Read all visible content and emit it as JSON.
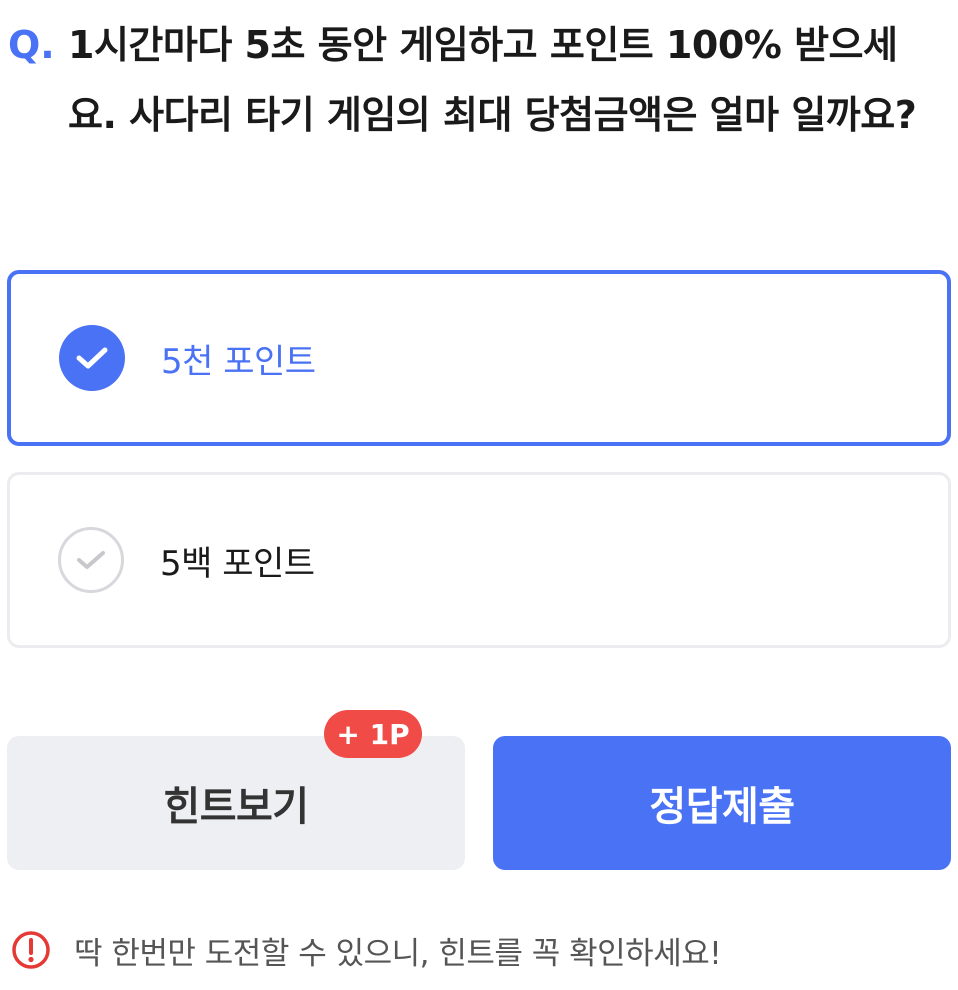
{
  "question": {
    "prefix": "Q.",
    "text": "1시간마다 5초 동안 게임하고 포인트 100% 받으세요. 사다리 타기 게임의 최대 당첨금액은 얼마 일까요?"
  },
  "options": [
    {
      "label": "5천 포인트",
      "selected": true
    },
    {
      "label": "5백 포인트",
      "selected": false
    }
  ],
  "buttons": {
    "hint_label": "힌트보기",
    "hint_badge": "+ 1P",
    "submit_label": "정답제출"
  },
  "notice": {
    "text": "딱 한번만 도전할 수 있으니, 힌트를 꼭 확인하세요!"
  },
  "colors": {
    "accent": "#4a72f5",
    "badge": "#f04b46",
    "warning": "#e53935"
  },
  "icons": {
    "check": "check-icon",
    "warning": "exclamation-circle-icon"
  }
}
